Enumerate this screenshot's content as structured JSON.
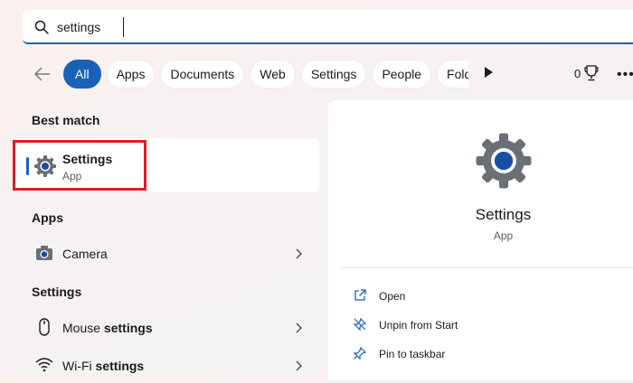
{
  "search": {
    "value": "settings"
  },
  "filters": {
    "chips": [
      "All",
      "Apps",
      "Documents",
      "Web",
      "Settings",
      "People",
      "Folde"
    ],
    "count": "0"
  },
  "left": {
    "best_match_heading": "Best match",
    "best_match": {
      "title": "Settings",
      "subtitle": "App"
    },
    "apps_heading": "Apps",
    "apps": [
      {
        "label": "Camera",
        "icon": "camera-icon"
      }
    ],
    "settings_heading": "Settings",
    "settings_items": [
      {
        "prefix": "Mouse ",
        "bold": "settings",
        "icon": "mouse-icon"
      },
      {
        "prefix": "Wi-Fi ",
        "bold": "settings",
        "icon": "wifi-icon"
      }
    ]
  },
  "panel": {
    "title": "Settings",
    "subtitle": "App",
    "actions": [
      {
        "label": "Open",
        "icon": "open-icon"
      },
      {
        "label": "Unpin from Start",
        "icon": "unpin-icon"
      },
      {
        "label": "Pin to taskbar",
        "icon": "pin-icon"
      }
    ]
  },
  "colors": {
    "accent": "#1a62b8",
    "highlight": "#e01b24"
  }
}
